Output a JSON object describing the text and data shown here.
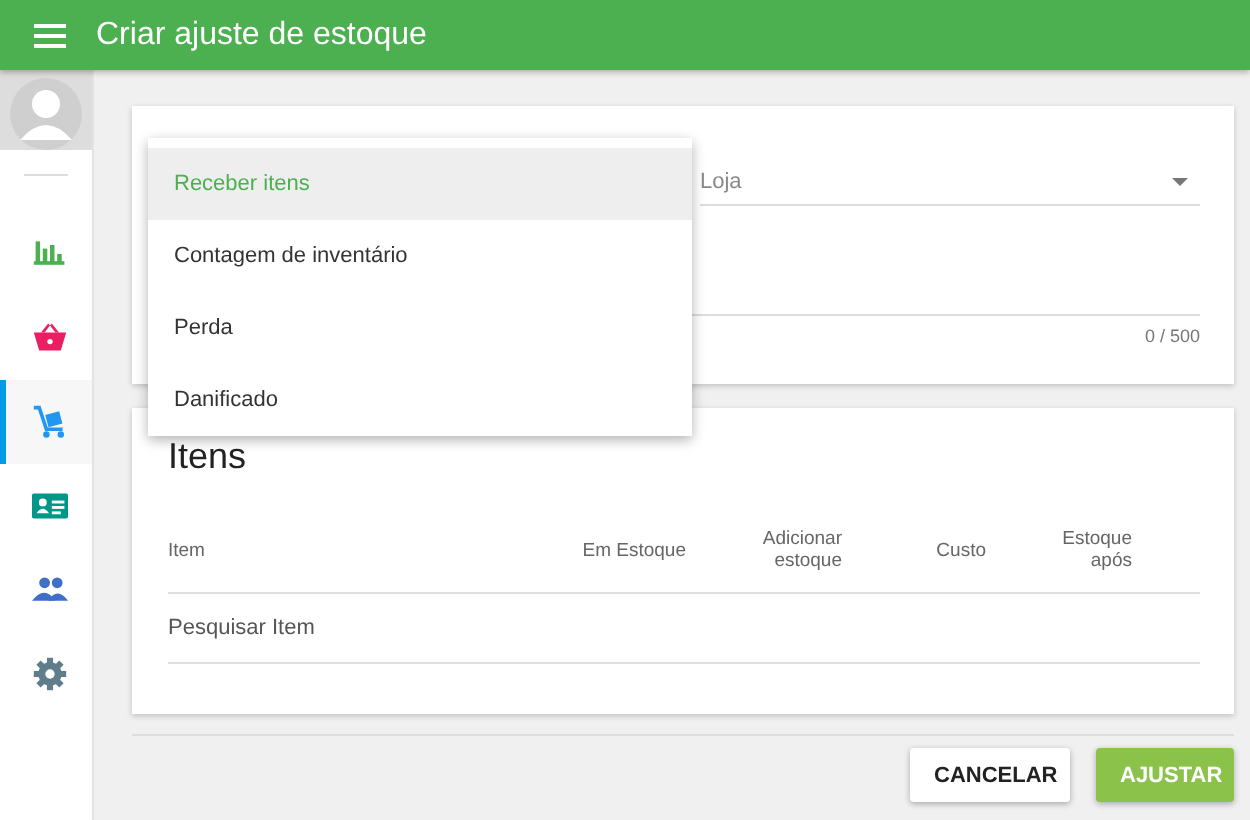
{
  "app_bar": {
    "title": "Criar ajuste de estoque"
  },
  "sidebar": {
    "items": [
      {
        "selected": false
      },
      {
        "selected": false
      },
      {
        "selected": true
      },
      {
        "selected": false
      },
      {
        "selected": false
      },
      {
        "selected": false
      }
    ]
  },
  "form": {
    "store_field": {
      "placeholder": "Loja"
    },
    "notes_field": {
      "counter": "0 / 500"
    }
  },
  "reason_menu": {
    "options": [
      {
        "label": "Receber itens",
        "selected": true
      },
      {
        "label": "Contagem de inventário",
        "selected": false
      },
      {
        "label": "Perda",
        "selected": false
      },
      {
        "label": "Danificado",
        "selected": false
      }
    ]
  },
  "items_card": {
    "title": "Itens",
    "columns": [
      "Item",
      "Em Estoque",
      "Adicionar estoque",
      "Custo",
      "Estoque após"
    ],
    "search": {
      "placeholder": "Pesquisar Item"
    }
  },
  "buttons": [
    {
      "label": "CANCELAR",
      "kind": "secondary"
    },
    {
      "label": "AJUSTAR",
      "kind": "primary"
    }
  ]
}
